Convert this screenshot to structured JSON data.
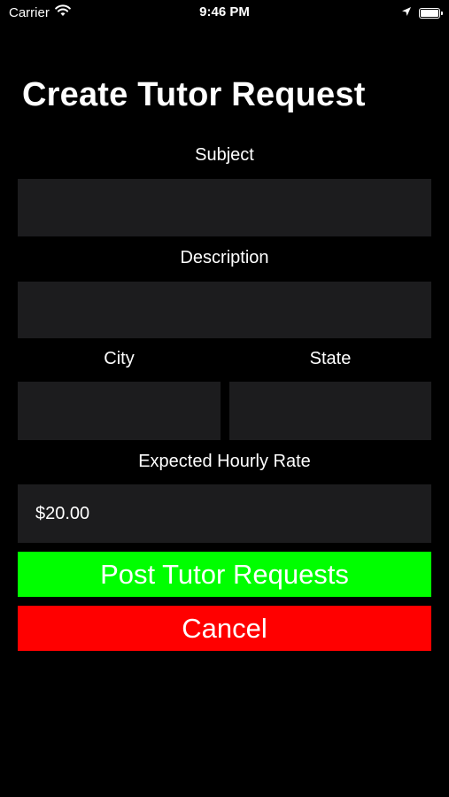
{
  "status_bar": {
    "carrier": "Carrier",
    "time": "9:46 PM",
    "icons": [
      "wifi-icon",
      "location-arrow-icon",
      "battery-icon"
    ]
  },
  "title": "Create Tutor Request",
  "form": {
    "subject": {
      "label": "Subject",
      "value": ""
    },
    "description": {
      "label": "Description",
      "value": ""
    },
    "city": {
      "label": "City",
      "value": ""
    },
    "state": {
      "label": "State",
      "value": ""
    },
    "rate": {
      "label": "Expected Hourly Rate",
      "value": "$20.00"
    }
  },
  "buttons": {
    "post": {
      "label": "Post Tutor Requests",
      "color": "#00ff00"
    },
    "cancel": {
      "label": "Cancel",
      "color": "#ff0000"
    }
  },
  "colors": {
    "background": "#000000",
    "field": "#1c1c1e",
    "text": "#ffffff"
  }
}
